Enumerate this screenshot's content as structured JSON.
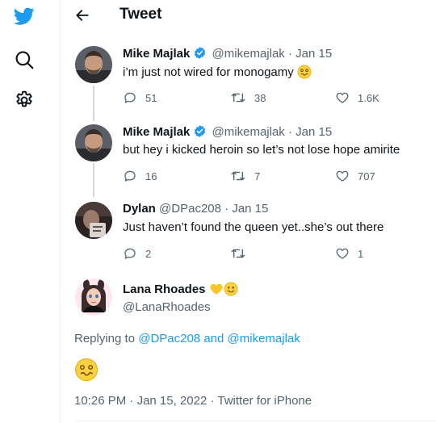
{
  "header": {
    "title": "Tweet"
  },
  "nav": {
    "icons": [
      "twitter-logo-icon",
      "search-icon",
      "settings-icon"
    ]
  },
  "colors": {
    "accent": "#1d9bf0",
    "text": "#0f1419",
    "muted": "#536471",
    "line": "#cfd9de"
  },
  "tweets": [
    {
      "name": "Mike Majlak",
      "verified": true,
      "handle": "@mikemajlak",
      "date": "Jan 15",
      "text": "i’m just not wired for monogamy",
      "emoji": "woozy-face",
      "replies": "51",
      "retweets": "38",
      "likes": "1.6K"
    },
    {
      "name": "Mike Majlak",
      "verified": true,
      "handle": "@mikemajlak",
      "date": "Jan 15",
      "text": "but hey i kicked heroin so let’s not lose hope amirite",
      "replies": "16",
      "retweets": "7",
      "likes": "707"
    },
    {
      "name": "Dylan",
      "handle": "@DPac208",
      "date": "Jan 15",
      "text": "Just haven’t found the queen yet..she’s out there",
      "replies": "2",
      "retweets": "",
      "likes": "1"
    }
  ],
  "focused": {
    "name": "Lana Rhoades",
    "name_emojis": [
      "yellow-heart",
      "smiling-face"
    ],
    "handle": "@LanaRhoades",
    "replying_prefix": "Replying to ",
    "replying_user1": "@DPac208",
    "replying_and": " and ",
    "replying_user2": "@mikemajlak",
    "tweet_emoji": "woozy-face",
    "time": "10:26 PM",
    "date": "Jan 15, 2022",
    "source": "Twitter for iPhone",
    "sep": " · "
  },
  "meta_sep": " · "
}
